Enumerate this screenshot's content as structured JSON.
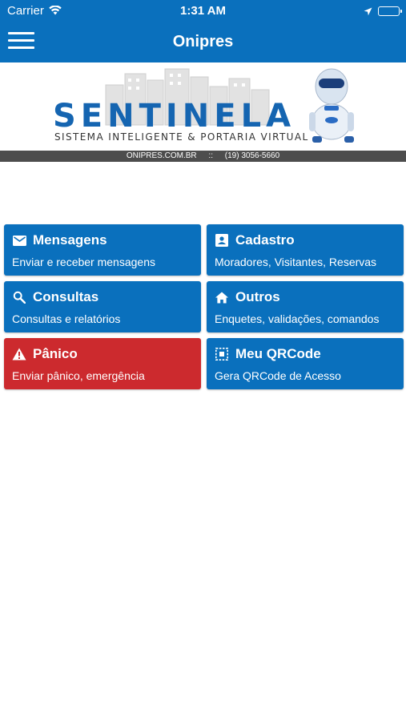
{
  "status_bar": {
    "carrier": "Carrier",
    "time": "1:31 AM"
  },
  "nav": {
    "title": "Onipres"
  },
  "banner": {
    "brand": "SENTINELA",
    "tagline": "SISTEMA INTELIGENTE & PORTARIA VIRTUAL",
    "website": "ONIPRES.COM.BR",
    "separator": "::",
    "phone": "(19) 3056-5660"
  },
  "menu": {
    "mensagens": {
      "label": "Mensagens",
      "sub": "Enviar e receber mensagens",
      "icon": "mail-icon"
    },
    "cadastro": {
      "label": "Cadastro",
      "sub": "Moradores, Visitantes, Reservas",
      "icon": "contact-card-icon"
    },
    "consultas": {
      "label": "Consultas",
      "sub": "Consultas e relatórios",
      "icon": "search-icon"
    },
    "outros": {
      "label": "Outros",
      "sub": "Enquetes, validações, comandos",
      "icon": "home-icon"
    },
    "panico": {
      "label": "Pânico",
      "sub": "Enviar pânico, emergência",
      "icon": "warning-icon"
    },
    "qrcode": {
      "label": "Meu QRCode",
      "sub": "Gera QRCode de Acesso",
      "icon": "qrcode-icon"
    }
  },
  "colors": {
    "primary": "#0a70bd",
    "danger": "#cc2a2e"
  }
}
